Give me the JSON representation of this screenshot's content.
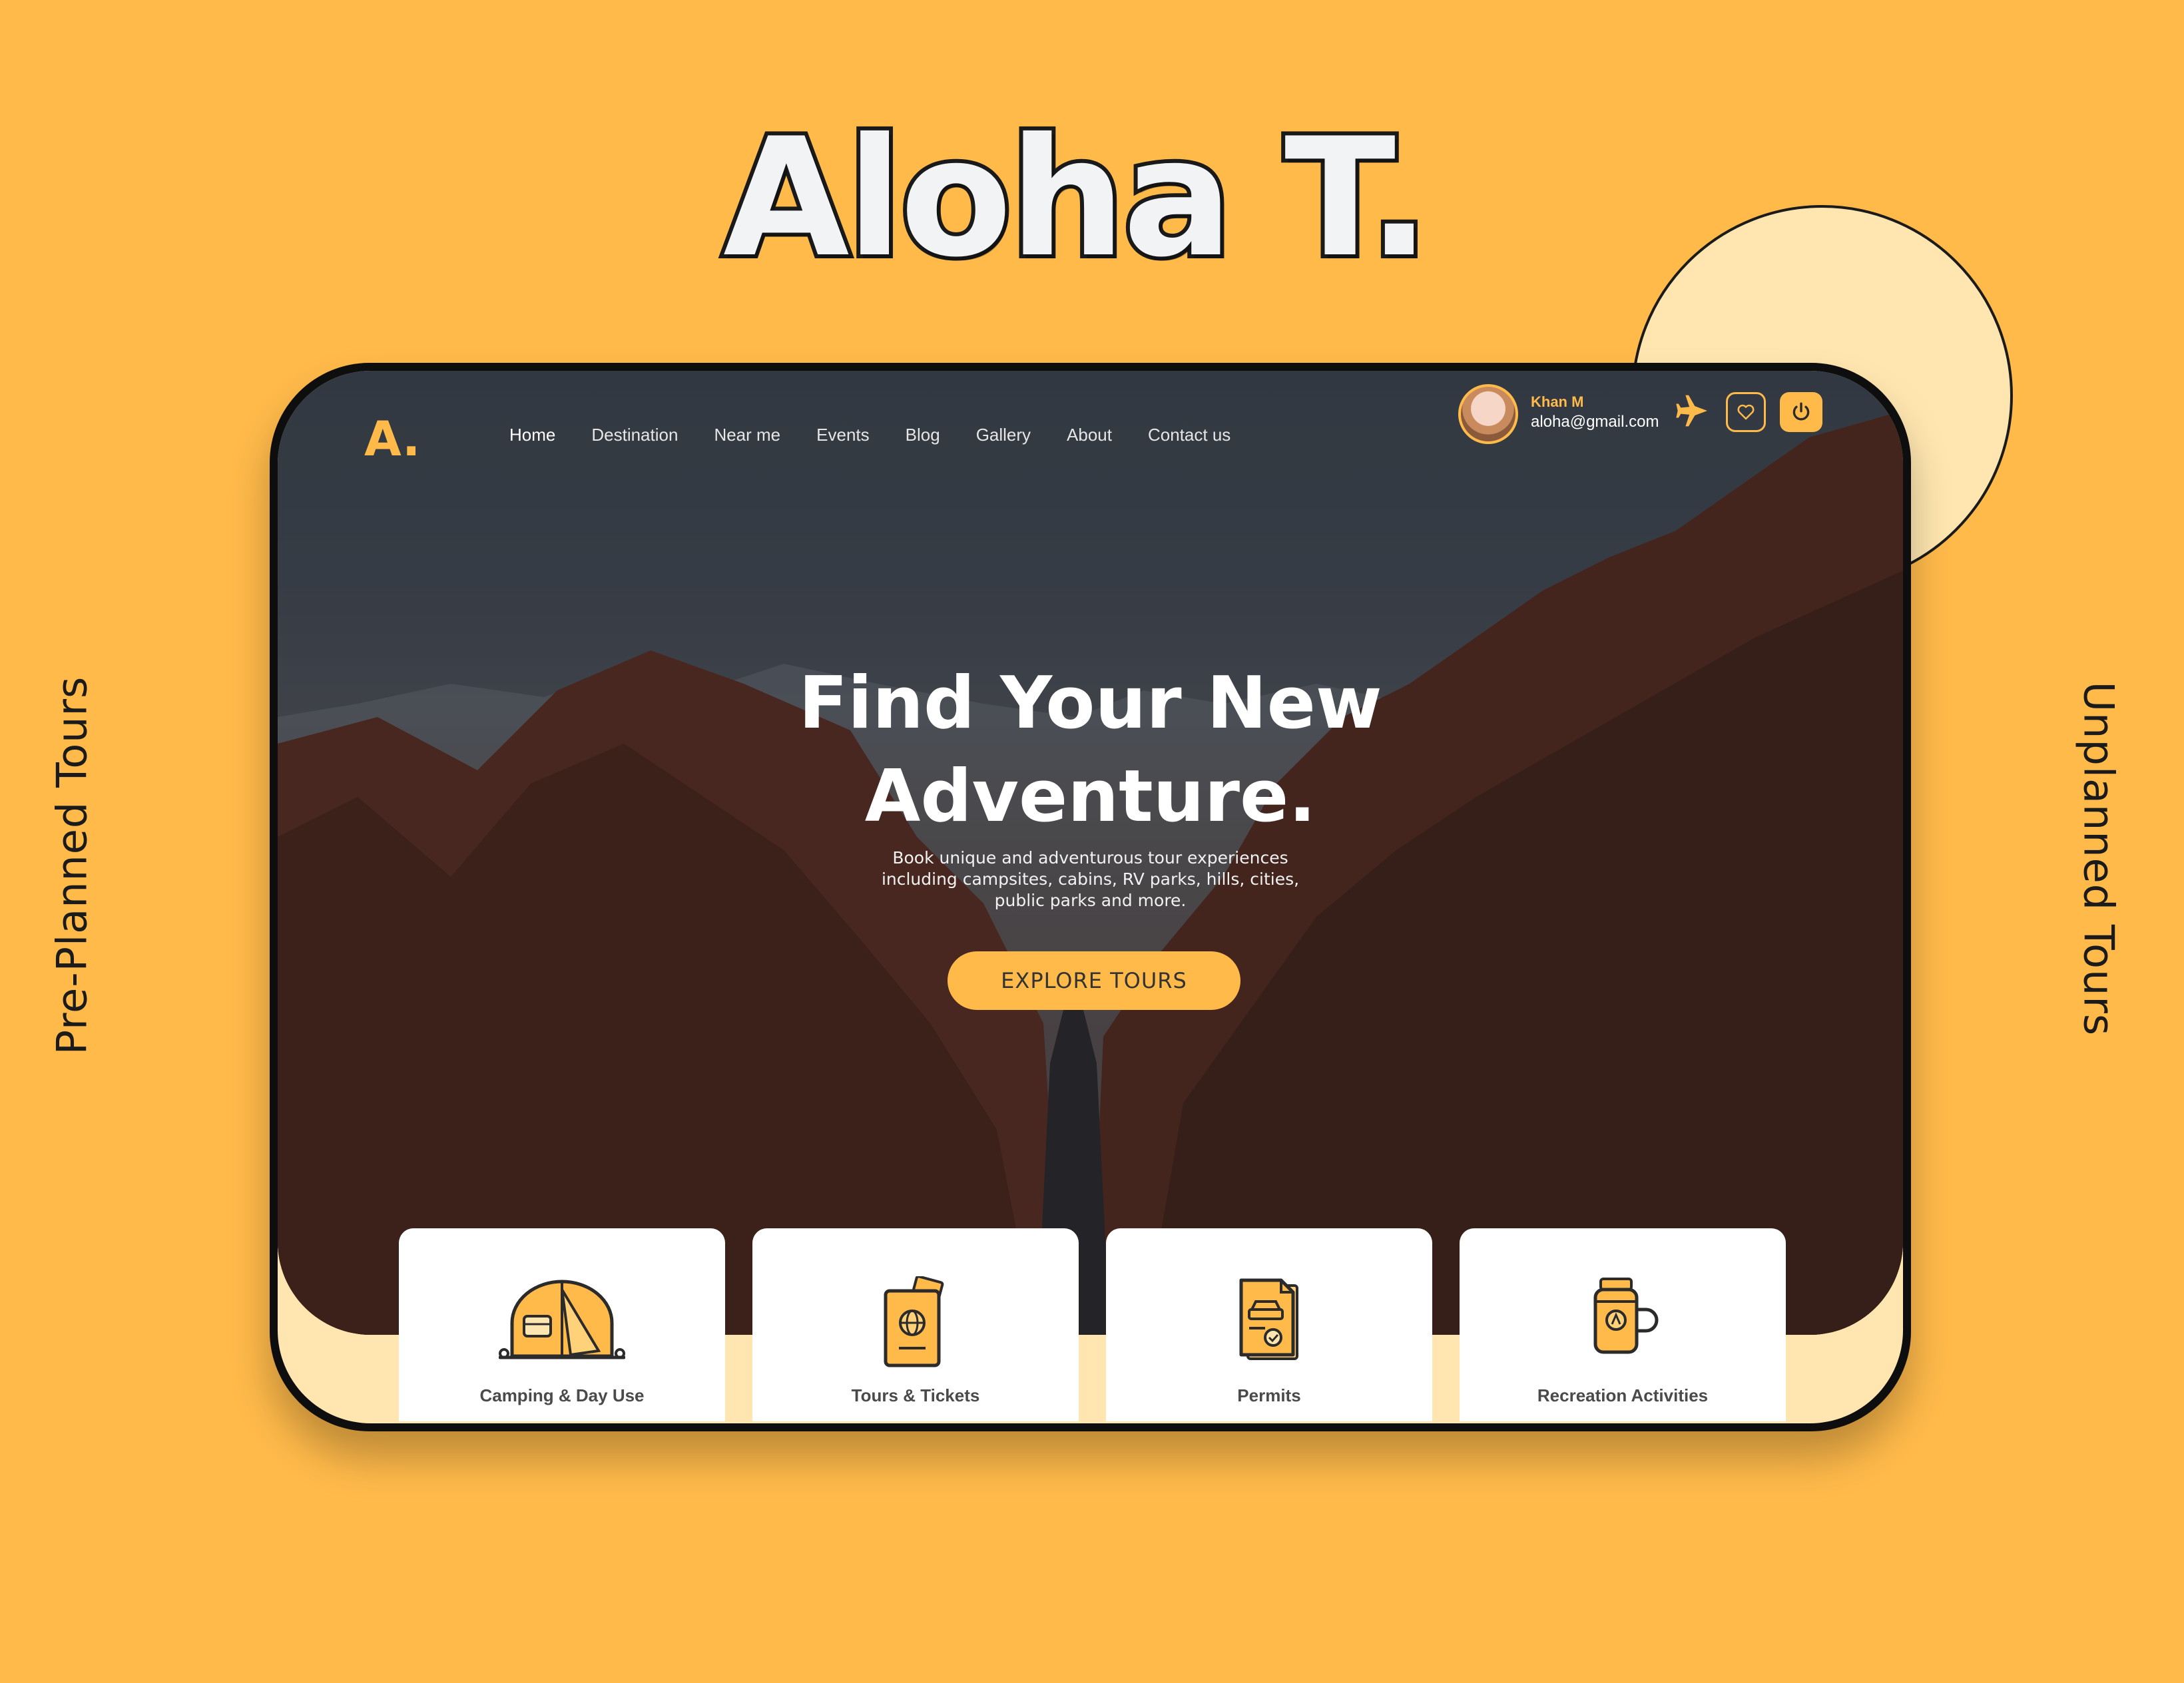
{
  "brand": {
    "title": "Aloha T.",
    "left_label": "Pre-Planned Tours",
    "right_label": "Unplanned Tours",
    "accent_color": "#FFBA4A",
    "light_color": "#FFE6B0"
  },
  "app": {
    "logo": "A.",
    "nav": [
      {
        "label": "Home",
        "active": true
      },
      {
        "label": "Destination",
        "active": false
      },
      {
        "label": "Near me",
        "active": false
      },
      {
        "label": "Events",
        "active": false
      },
      {
        "label": "Blog",
        "active": false
      },
      {
        "label": "Gallery",
        "active": false
      },
      {
        "label": "About",
        "active": false
      },
      {
        "label": "Contact us",
        "active": false
      }
    ],
    "user": {
      "name": "Khan M",
      "email": "aloha@gmail.com",
      "avatar_icon": "avatar"
    },
    "header_icons": [
      "plane-icon",
      "heart-icon",
      "power-icon"
    ],
    "hero": {
      "title_line1": "Find Your New",
      "title_line2": "Adventure.",
      "subtitle": "Book unique and adventurous tour experiences including campsites, cabins, RV parks, hills, cities, public parks and more.",
      "cta": "EXPLORE TOURS"
    },
    "cards": [
      {
        "label": "Camping & Day Use",
        "icon": "tent-icon"
      },
      {
        "label": "Tours & Tickets",
        "icon": "passport-icon"
      },
      {
        "label": "Permits",
        "icon": "permit-icon"
      },
      {
        "label": "Recreation Activities",
        "icon": "flask-icon"
      }
    ]
  }
}
